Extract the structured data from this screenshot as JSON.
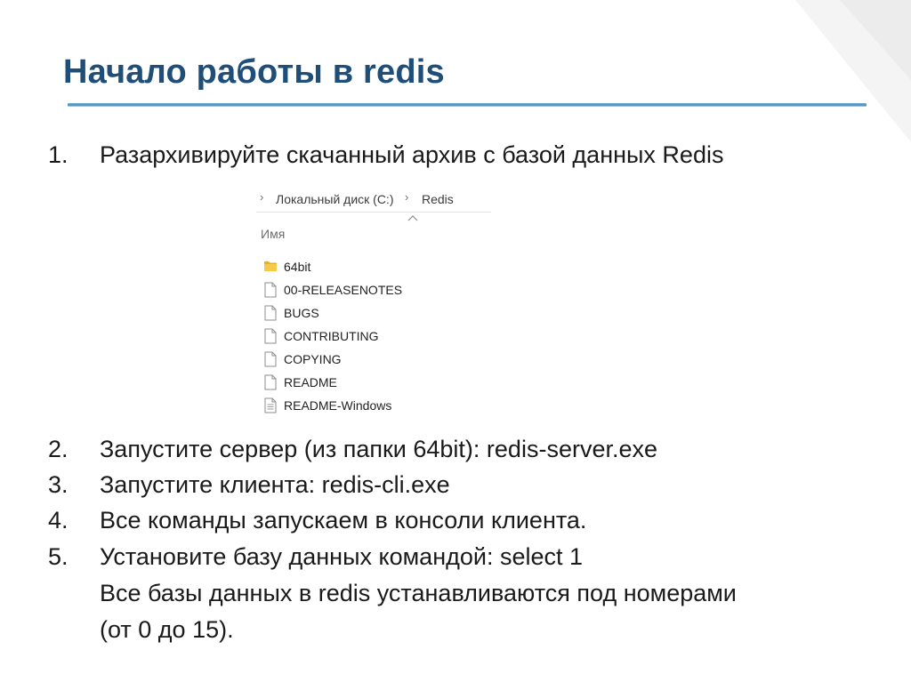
{
  "slide": {
    "title": "Начало работы в redis",
    "accent_color": "#1f4e79",
    "rule_color": "#4b8fbd"
  },
  "steps": [
    {
      "number": "1.",
      "text": "Разархивируйте скачанный архив с базой данных Redis"
    },
    {
      "number": "2.",
      "text": "Запустите сервер (из папки 64bit): redis-server.exe"
    },
    {
      "number": "3.",
      "text": "Запустите клиента: redis-cli.exe"
    },
    {
      "number": "4.",
      "text": "Все команды запускаем в консоли клиента."
    },
    {
      "number": "5.",
      "text": "Установите базу данных командой: select 1",
      "continuation": [
        "Все базы данных в redis устанавливаются под номерами",
        "(от 0 до 15)."
      ]
    }
  ],
  "explorer": {
    "breadcrumb": [
      "Локальный диск (C:)",
      "Redis"
    ],
    "column_header": "Имя",
    "files": [
      {
        "name": "64bit",
        "icon": "folder-icon"
      },
      {
        "name": "00-RELEASENOTES",
        "icon": "file-icon"
      },
      {
        "name": "BUGS",
        "icon": "file-icon"
      },
      {
        "name": "CONTRIBUTING",
        "icon": "file-icon"
      },
      {
        "name": "COPYING",
        "icon": "file-icon"
      },
      {
        "name": "README",
        "icon": "file-icon"
      },
      {
        "name": "README-Windows",
        "icon": "document-icon"
      }
    ]
  }
}
